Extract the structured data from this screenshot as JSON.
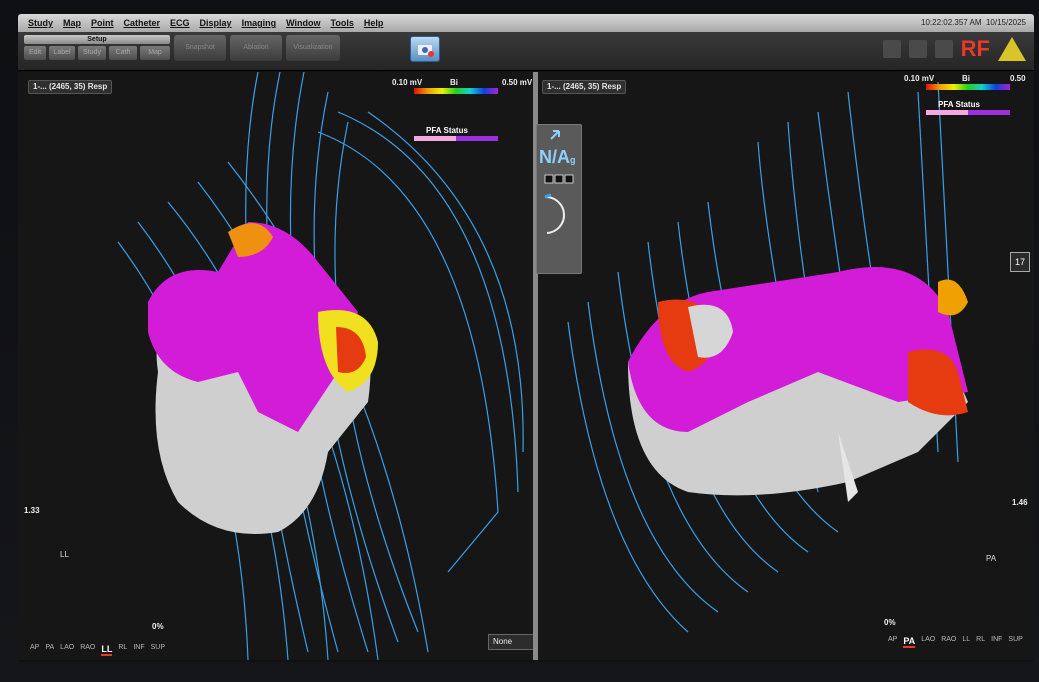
{
  "menu": [
    "Study",
    "Map",
    "Point",
    "Catheter",
    "ECG",
    "Display",
    "Imaging",
    "Window",
    "Tools",
    "Help"
  ],
  "status": {
    "time": "10:22:02.357 AM",
    "date": "10/15/2025"
  },
  "toolbar": {
    "setup_label": "Setup",
    "small_buttons": [
      "Edit",
      "Label",
      "Study",
      "Cath",
      "Map"
    ],
    "big_buttons": [
      "Snapshot",
      "Ablation",
      "Visualization"
    ],
    "rf_label": "RF"
  },
  "left_view": {
    "dropdown": "1-... (2465, 35) Resp",
    "scale_min": "0.10 mV",
    "scale_type": "Bi",
    "scale_max": "0.50 mV",
    "pfa_label": "PFA Status",
    "side_scale": "1.33",
    "orientation": "LL",
    "zoom_pct": "0%",
    "views": [
      "AP",
      "PA",
      "LAO",
      "RAO",
      "LL",
      "RL",
      "INF",
      "SUP"
    ],
    "active_view": "LL",
    "overlay_dropdown": "None"
  },
  "right_view": {
    "dropdown": "1-... (2465, 35) Resp",
    "scale_min": "0.10 mV",
    "scale_type": "Bi",
    "scale_max": "0.50",
    "pfa_label": "PFA Status",
    "side_scale": "1.46",
    "orientation": "PA",
    "zoom_pct": "0%",
    "views": [
      "AP",
      "PA",
      "LAO",
      "RAO",
      "LL",
      "RL",
      "INF",
      "SUP"
    ],
    "active_view": "PA",
    "tool_count": "17"
  },
  "na_panel": {
    "value": "N/A",
    "sub": "g"
  },
  "colors": {
    "map_magenta": "#d21cd8",
    "scar_gray": "#c8c8c8",
    "mesh_blue": "#3a9fe8",
    "rf_red": "#e8392a"
  }
}
